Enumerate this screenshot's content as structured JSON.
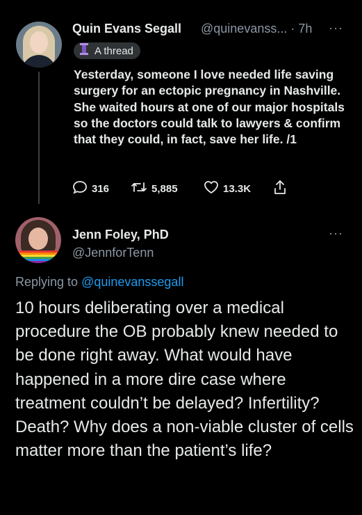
{
  "tweet1": {
    "name": "Quin Evans Segall",
    "meta": "@quinevanss... · 7h",
    "more": "···",
    "badge": "A thread",
    "body": "Yesterday, someone I love needed life saving surgery for an ectopic pregnancy in Nashville. She waited hours at one of our major hospitals so the doctors could talk to lawyers & confirm that they could, in fact, save her life. /1",
    "replies": "316",
    "retweets": "5,885",
    "likes": "13.3K"
  },
  "tweet2": {
    "name": "Jenn Foley, PhD",
    "handle": "@JennforTenn",
    "more": "···",
    "replying_prefix": "Replying to",
    "replying_handle": "@quinevanssegall",
    "body": "10 hours deliberating over a medical procedure the OB probably knew needed to be done right away. What would have happened in a more dire case where treatment couldn’t be delayed? Infertility? Death? Why does a non-viable cluster of cells matter more than the patient’s life?"
  },
  "colors": {
    "background": "#000000",
    "text": "#e7e9ea",
    "secondary": "#8b98a5",
    "link": "#1d9bf0",
    "badge_bg": "#2f3336"
  }
}
